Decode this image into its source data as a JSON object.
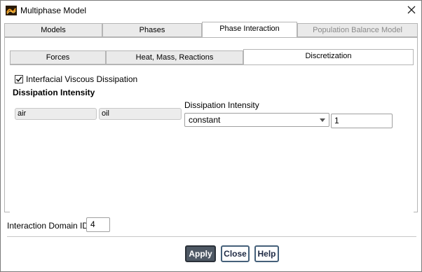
{
  "window": {
    "title": "Multiphase Model"
  },
  "tabs": [
    {
      "label": "Models"
    },
    {
      "label": "Phases"
    },
    {
      "label": "Phase Interaction"
    },
    {
      "label": "Population Balance Model"
    }
  ],
  "subtabs": [
    {
      "label": "Forces"
    },
    {
      "label": "Heat, Mass, Reactions"
    },
    {
      "label": "Discretization"
    }
  ],
  "checkbox": {
    "label": "Interfacial Viscous Dissipation",
    "checked": true
  },
  "section_title": "Dissipation Intensity",
  "phase_pair": {
    "phase1": "air",
    "phase2": "oil"
  },
  "dissipation": {
    "label": "Dissipation Intensity",
    "method": "constant",
    "value": "1"
  },
  "interaction_domain": {
    "label": "Interaction Domain ID",
    "value": "4"
  },
  "buttons": {
    "apply": "Apply",
    "close": "Close",
    "help": "Help"
  },
  "colors": {
    "apply_bg": "#4e5864",
    "button_border": "#45607a",
    "tab_inactive": "#eaeaea"
  }
}
